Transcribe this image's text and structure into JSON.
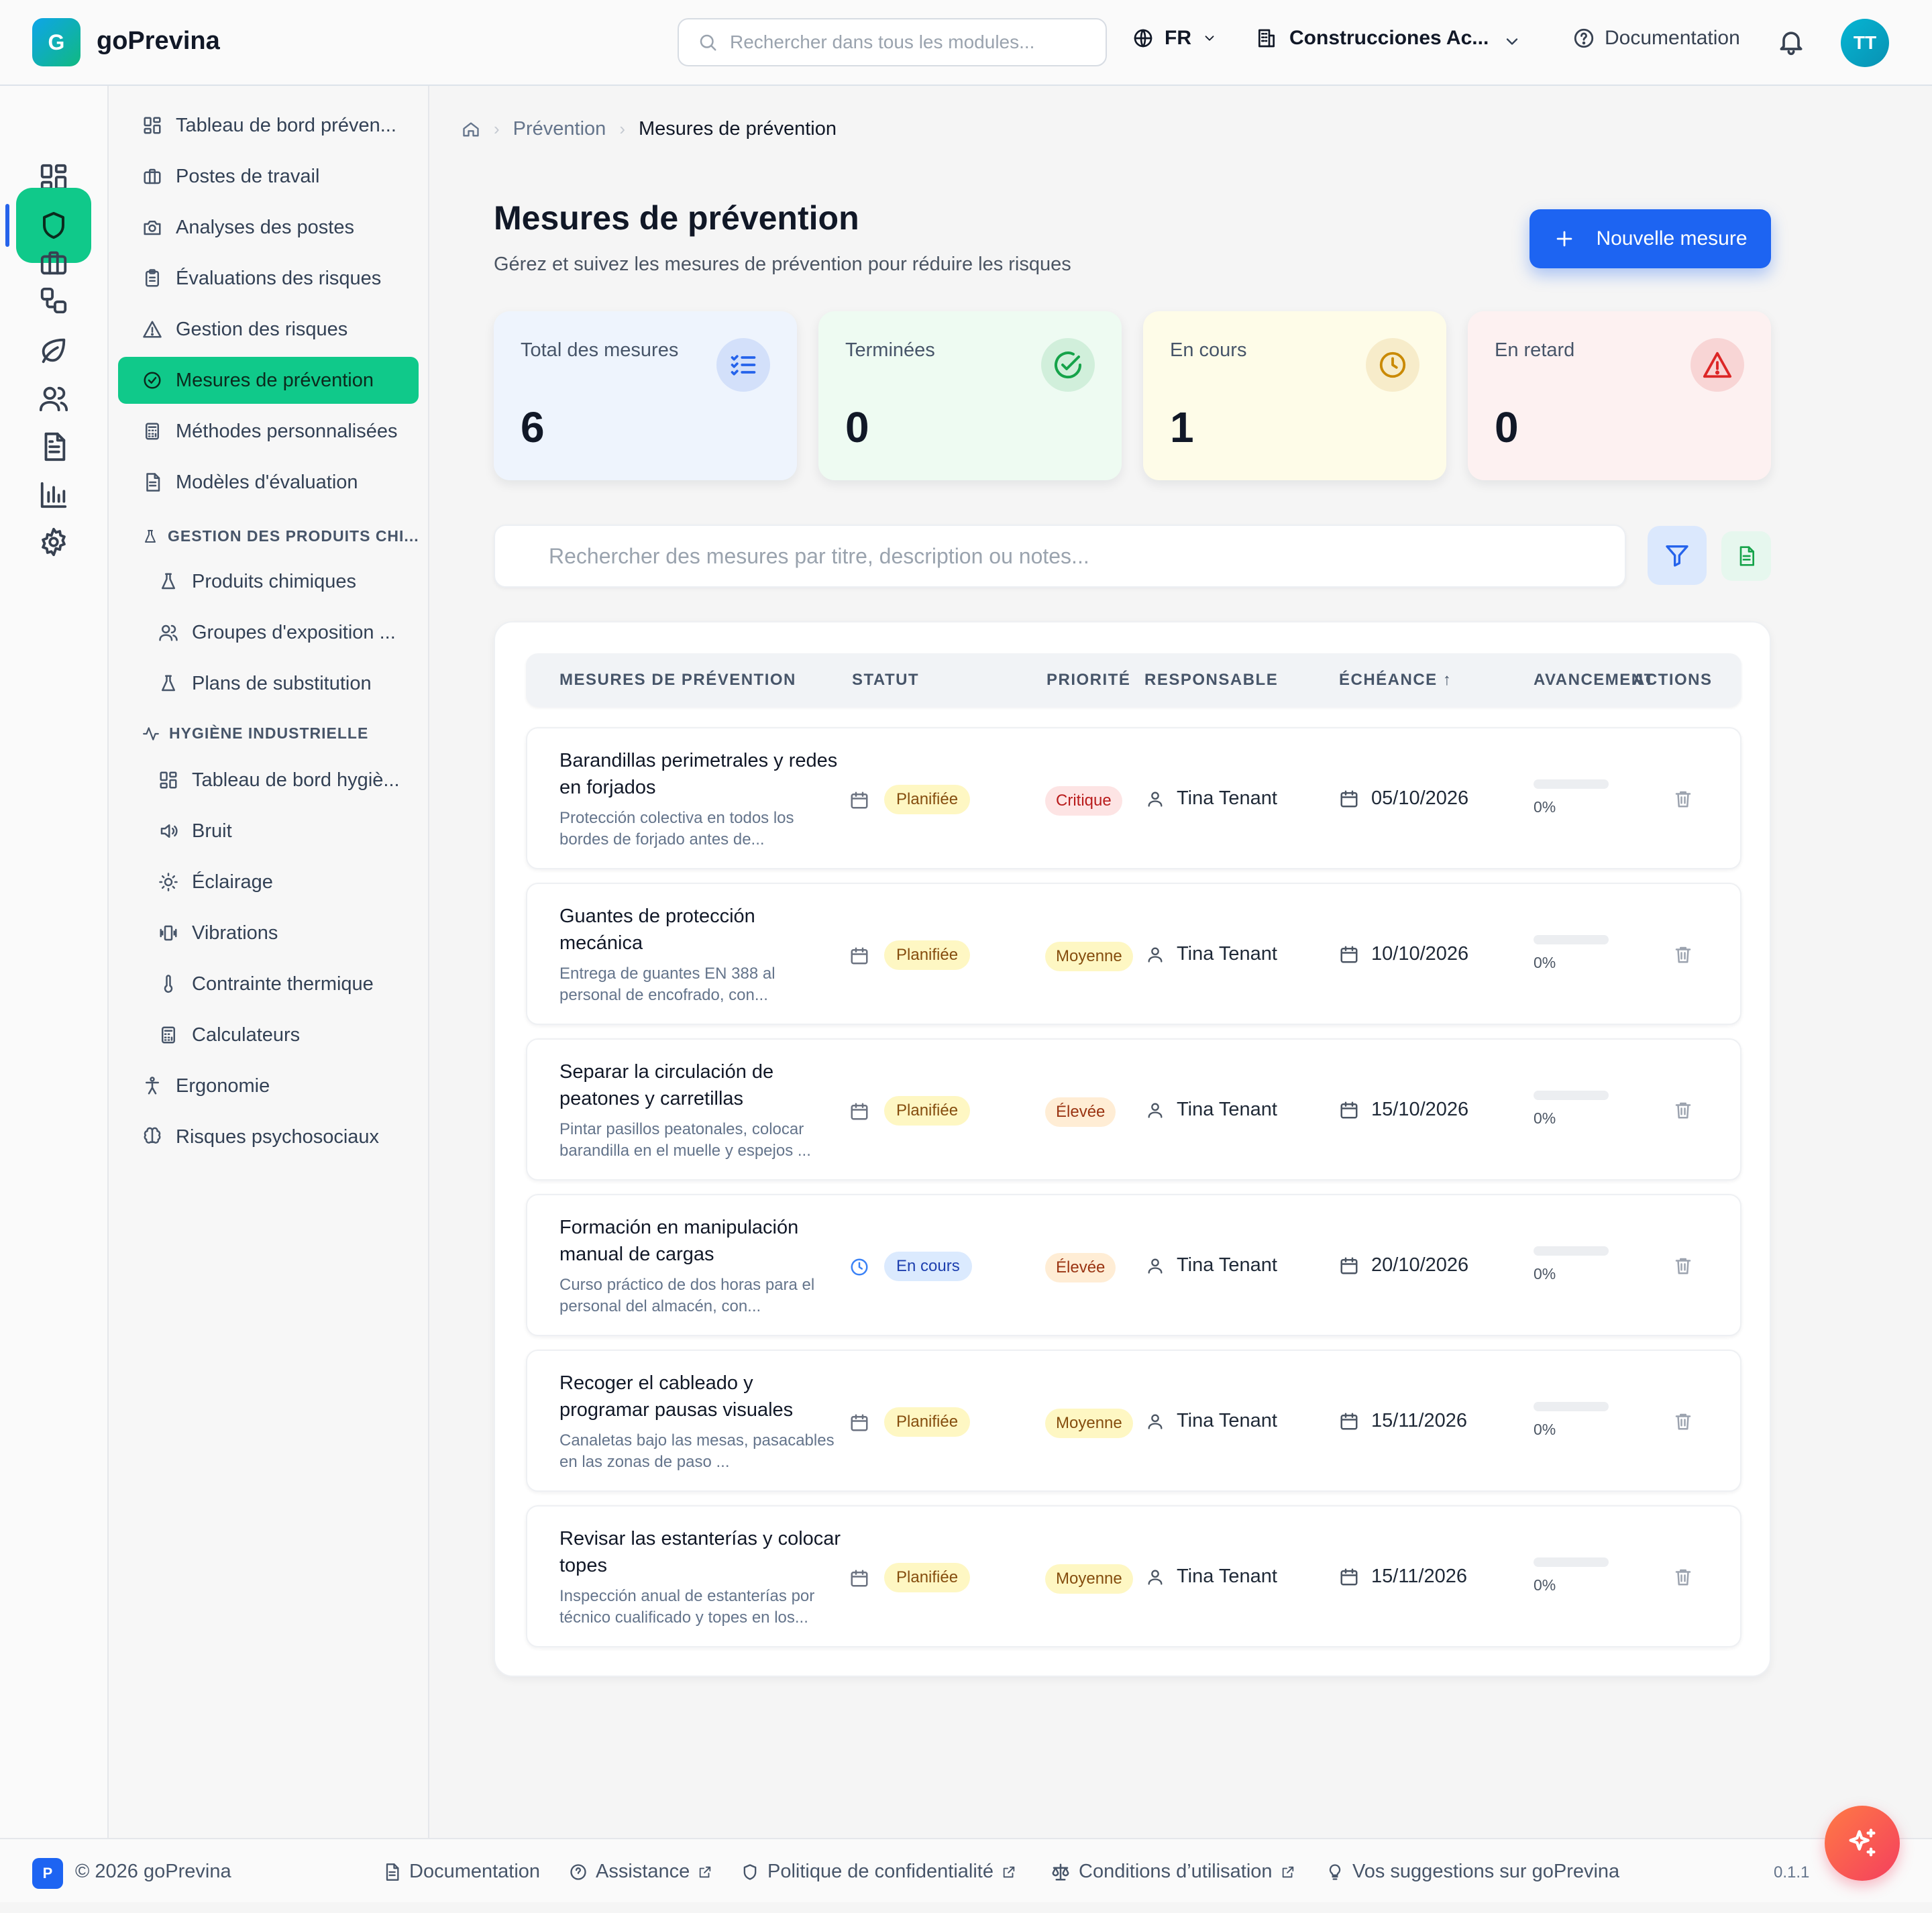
{
  "app": {
    "logo_letter": "G",
    "name": "goPrevina"
  },
  "topbar": {
    "search_placeholder": "Rechercher dans tous les modules...",
    "language": "FR",
    "company": "Construcciones Ac...",
    "documentation": "Documentation",
    "avatar_initials": "TT"
  },
  "rail": {
    "items": [
      "dashboard",
      "prevention",
      "briefcase",
      "workflow",
      "environment",
      "users",
      "documents",
      "reports",
      "settings"
    ],
    "active": "prevention"
  },
  "sidebar": {
    "items": [
      {
        "label": "Tableau de bord préven...",
        "icon": "dashboard-icon"
      },
      {
        "label": "Postes de travail",
        "icon": "briefcase-icon"
      },
      {
        "label": "Analyses des postes",
        "icon": "camera-icon"
      },
      {
        "label": "Évaluations des risques",
        "icon": "clipboard-icon"
      },
      {
        "label": "Gestion des risques",
        "icon": "warning-icon"
      },
      {
        "label": "Mesures de prévention",
        "icon": "check-circle-icon",
        "active": true
      },
      {
        "label": "Méthodes personnalisées",
        "icon": "calculator-icon"
      },
      {
        "label": "Modèles d'évaluation",
        "icon": "file-text-icon"
      }
    ],
    "section_chemicals": "GESTION DES PRODUITS CHI...",
    "chemicals": [
      {
        "label": "Produits chimiques",
        "icon": "flask-icon"
      },
      {
        "label": "Groupes d'exposition ...",
        "icon": "users-icon"
      },
      {
        "label": "Plans de substitution",
        "icon": "flask-icon"
      }
    ],
    "section_hygiene": "HYGIÈNE INDUSTRIELLE",
    "hygiene": [
      {
        "label": "Tableau de bord hygiè...",
        "icon": "dashboard-icon"
      },
      {
        "label": "Bruit",
        "icon": "speaker-icon"
      },
      {
        "label": "Éclairage",
        "icon": "sun-icon"
      },
      {
        "label": "Vibrations",
        "icon": "vibrate-icon"
      },
      {
        "label": "Contrainte thermique",
        "icon": "thermometer-icon"
      },
      {
        "label": "Calculateurs",
        "icon": "calculator-icon"
      }
    ],
    "bottom": [
      {
        "label": "Ergonomie",
        "icon": "person-icon"
      },
      {
        "label": "Risques psychosociaux",
        "icon": "brain-icon"
      }
    ]
  },
  "breadcrumb": {
    "section": "Prévention",
    "current": "Mesures de prévention"
  },
  "page": {
    "title": "Mesures de prévention",
    "subtitle": "Gérez et suivez les mesures de prévention pour réduire les risques",
    "new_button": "Nouvelle mesure"
  },
  "stats": [
    {
      "label": "Total des mesures",
      "value": "6",
      "color": "#eef4fd",
      "accent": "#2563eb",
      "icon": "list-check-icon"
    },
    {
      "label": "Terminées",
      "value": "0",
      "color": "#eefbf2",
      "accent": "#16a34a",
      "icon": "check-circle-icon"
    },
    {
      "label": "En cours",
      "value": "1",
      "color": "#fefce8",
      "accent": "#ca8a04",
      "icon": "clock-icon"
    },
    {
      "label": "En retard",
      "value": "0",
      "color": "#fdf1f1",
      "accent": "#dc2626",
      "icon": "alert-triangle-icon"
    }
  ],
  "measure_search_placeholder": "Rechercher des mesures par titre, description ou notes...",
  "table": {
    "headers": {
      "measure": "MESURES DE PRÉVENTION",
      "status": "STATUT",
      "priority": "PRIORITÉ",
      "owner": "RESPONSABLE",
      "due": "ÉCHÉANCE ↑",
      "progress": "AVANCEMENT",
      "actions": "ACTIONS"
    },
    "rows": [
      {
        "title": "Barandillas perimetrales y redes en forjados",
        "desc": "Protección colectiva en todos los bordes de forjado antes de...",
        "status": "Planifiée",
        "status_kind": "planned",
        "priority": "Critique",
        "priority_kind": "critique",
        "owner": "Tina Tenant",
        "due": "05/10/2026",
        "progress": 0,
        "progress_label": "0%"
      },
      {
        "title": "Guantes de protección mecánica",
        "desc": "Entrega de guantes EN 388 al personal de encofrado, con...",
        "status": "Planifiée",
        "status_kind": "planned",
        "priority": "Moyenne",
        "priority_kind": "moyenne",
        "owner": "Tina Tenant",
        "due": "10/10/2026",
        "progress": 0,
        "progress_label": "0%"
      },
      {
        "title": "Separar la circulación de peatones y carretillas",
        "desc": "Pintar pasillos peatonales, colocar barandilla en el muelle y espejos ...",
        "status": "Planifiée",
        "status_kind": "planned",
        "priority": "Élevée",
        "priority_kind": "elevee",
        "owner": "Tina Tenant",
        "due": "15/10/2026",
        "progress": 0,
        "progress_label": "0%"
      },
      {
        "title": "Formación en manipulación manual de cargas",
        "desc": "Curso práctico de dos horas para el personal del almacén, con...",
        "status": "En cours",
        "status_kind": "progress",
        "priority": "Élevée",
        "priority_kind": "elevee",
        "owner": "Tina Tenant",
        "due": "20/10/2026",
        "progress": 0,
        "progress_label": "0%"
      },
      {
        "title": "Recoger el cableado y programar pausas visuales",
        "desc": "Canaletas bajo las mesas, pasacables en las zonas de paso ...",
        "status": "Planifiée",
        "status_kind": "planned",
        "priority": "Moyenne",
        "priority_kind": "moyenne",
        "owner": "Tina Tenant",
        "due": "15/11/2026",
        "progress": 0,
        "progress_label": "0%"
      },
      {
        "title": "Revisar las estanterías y colocar topes",
        "desc": "Inspección anual de estanterías por técnico cualificado y topes en los...",
        "status": "Planifiée",
        "status_kind": "planned",
        "priority": "Moyenne",
        "priority_kind": "moyenne",
        "owner": "Tina Tenant",
        "due": "15/11/2026",
        "progress": 0,
        "progress_label": "0%"
      }
    ]
  },
  "footer": {
    "badge": "P",
    "copyright": "© 2026 goPrevina",
    "links": [
      {
        "label": "Documentation",
        "icon": "file-icon"
      },
      {
        "label": "Assistance",
        "icon": "help-icon",
        "external": true
      },
      {
        "label": "Politique de confidentialité",
        "icon": "shield-icon",
        "external": true
      },
      {
        "label": "Conditions d’utilisation",
        "icon": "scale-icon",
        "external": true
      },
      {
        "label": "Vos suggestions sur goPrevina",
        "icon": "lightbulb-icon"
      }
    ],
    "version": "0.1.1"
  }
}
